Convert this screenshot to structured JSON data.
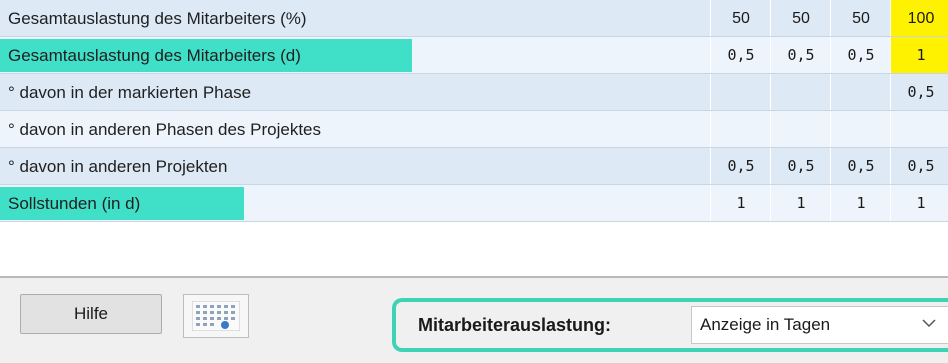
{
  "table": {
    "rows": [
      {
        "label": "Gesamtauslastung des Mitarbeiters (%)",
        "highlight": false,
        "mono": false,
        "values": [
          "50",
          "50",
          "50",
          "100"
        ]
      },
      {
        "label": "Gesamtauslastung des Mitarbeiters (d)",
        "highlight": true,
        "mono": true,
        "values": [
          "0,5",
          "0,5",
          "0,5",
          "1"
        ]
      },
      {
        "label": "° davon in der markierten Phase",
        "highlight": false,
        "mono": true,
        "values": [
          "",
          "",
          "",
          "0,5"
        ]
      },
      {
        "label": "° davon in anderen Phasen des Projektes",
        "highlight": false,
        "mono": true,
        "values": [
          "",
          "",
          "",
          ""
        ]
      },
      {
        "label": "° davon in anderen Projekten",
        "highlight": false,
        "mono": true,
        "values": [
          "0,5",
          "0,5",
          "0,5",
          "0,5"
        ]
      },
      {
        "label": "Sollstunden (in d)",
        "highlight": true,
        "mono": true,
        "values": [
          "1",
          "1",
          "1",
          "1"
        ]
      }
    ],
    "yellow_column_index": 3,
    "yellow_rows": [
      0,
      1
    ]
  },
  "footer": {
    "help_label": "Hilfe",
    "calendar_icon": "calendar-icon",
    "auslastung_label": "Mitarbeiterauslastung:",
    "auslastung_value": "Anzeige in Tagen",
    "dropdown_icon": "chevron-down-icon"
  },
  "colors": {
    "row_odd": "#dde9f5",
    "row_even": "#eef4fb",
    "highlight": "#40e0c8",
    "yellow": "#fff200",
    "focus_border": "#3fd3b5"
  }
}
